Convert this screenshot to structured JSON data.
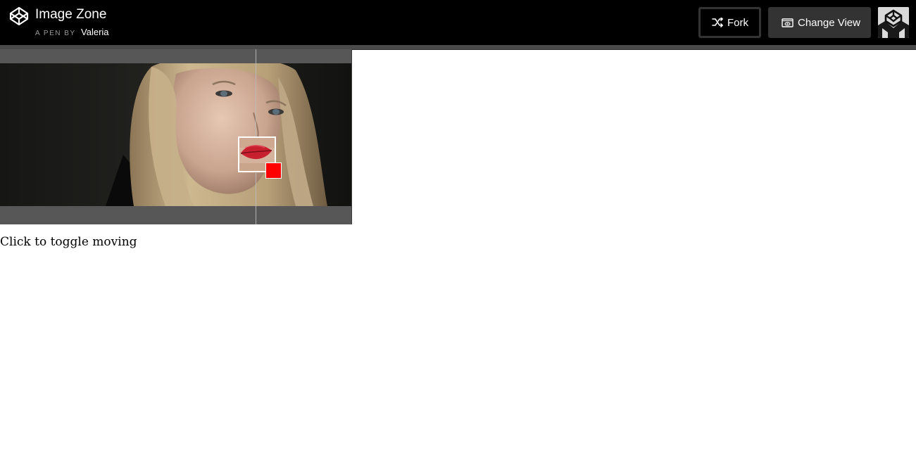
{
  "header": {
    "logo_icon": "codepen-logo-icon",
    "title": "Image Zone",
    "byline_prefix": "A PEN BY",
    "author": "Valeria",
    "fork_label": "Fork",
    "fork_icon": "fork-icon",
    "change_view_label": "Change View",
    "change_view_icon": "eye-view-icon",
    "avatar_icon": "codepen-avatar-icon"
  },
  "demo": {
    "background_color": "#575757",
    "handle_color": "#ff0000",
    "hint": "Click to toggle moving"
  }
}
